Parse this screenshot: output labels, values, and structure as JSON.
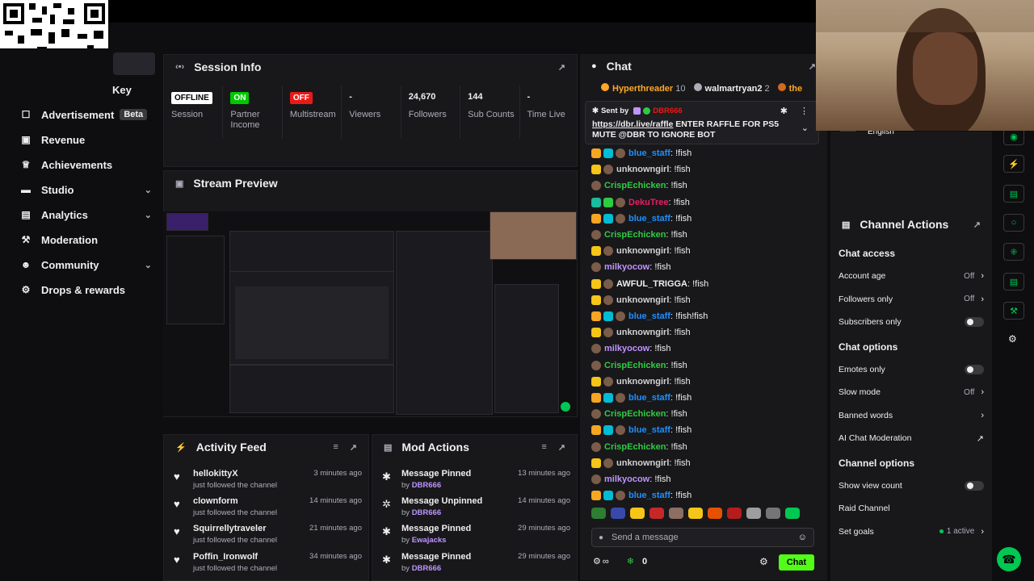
{
  "sidebar": {
    "key_label": "Key",
    "items": [
      {
        "label": "Advertisement",
        "badge": "Beta",
        "icon": "ad-icon"
      },
      {
        "label": "Revenue",
        "icon": "revenue-icon"
      },
      {
        "label": "Achievements",
        "icon": "trophy-icon"
      },
      {
        "label": "Studio",
        "icon": "studio-icon",
        "chevron": true
      },
      {
        "label": "Analytics",
        "icon": "analytics-icon",
        "chevron": true
      },
      {
        "label": "Moderation",
        "icon": "wrench-icon"
      },
      {
        "label": "Community",
        "icon": "community-icon",
        "chevron": true
      },
      {
        "label": "Drops & rewards",
        "icon": "drops-icon"
      }
    ]
  },
  "session": {
    "title": "Session Info",
    "stats": [
      {
        "value": "OFFLINE",
        "label": "Session",
        "kind": "tag",
        "color": "#ffffff",
        "text_color": "#000000"
      },
      {
        "value": "ON",
        "label": "Partner Income",
        "kind": "tag",
        "color": "#00c800",
        "text_color": "#ffffff"
      },
      {
        "value": "OFF",
        "label": "Multistream",
        "kind": "tag",
        "color": "#e91916",
        "text_color": "#ffffff"
      },
      {
        "value": "-",
        "label": "Viewers",
        "kind": "text"
      },
      {
        "value": "24,670",
        "label": "Followers",
        "kind": "text"
      },
      {
        "value": "144",
        "label": "Sub Counts",
        "kind": "text"
      },
      {
        "value": "-",
        "label": "Time Live",
        "kind": "text"
      }
    ]
  },
  "preview": {
    "title": "Stream Preview"
  },
  "activity": {
    "title": "Activity Feed",
    "items": [
      {
        "name": "hellokittyX",
        "sub": "just followed the channel",
        "time": "3 minutes ago"
      },
      {
        "name": "clownform",
        "sub": "just followed the channel",
        "time": "14 minutes ago"
      },
      {
        "name": "Squirrellytraveler",
        "sub": "just followed the channel",
        "time": "21 minutes ago"
      },
      {
        "name": "Poffin_Ironwolf",
        "sub": "just followed the channel",
        "time": "34 minutes ago"
      }
    ]
  },
  "mod": {
    "title": "Mod Actions",
    "items": [
      {
        "action": "Message Pinned",
        "by_label": "by",
        "by": "DBR666",
        "time": "13 minutes ago",
        "icon": "pin-icon"
      },
      {
        "action": "Message Unpinned",
        "by_label": "by",
        "by": "DBR666",
        "time": "14 minutes ago",
        "icon": "unpin-icon"
      },
      {
        "action": "Message Pinned",
        "by_label": "by",
        "by": "Ewajacks",
        "time": "29 minutes ago",
        "icon": "pin-icon"
      },
      {
        "action": "Message Pinned",
        "by_label": "by",
        "by": "DBR666",
        "time": "29 minutes ago",
        "icon": "pin-icon"
      }
    ]
  },
  "chat": {
    "title": "Chat",
    "leaderboard": [
      {
        "name": "Hyperthreader",
        "count": "10",
        "color": "#ffa726"
      },
      {
        "name": "walmartryan2",
        "count": "2",
        "color": "#efeff1"
      },
      {
        "name": "the",
        "count": "",
        "color": "#ffa726"
      }
    ],
    "pinned": {
      "sent_by": "Sent by",
      "author": "DBR666",
      "link": "https://dbr.live/raffle",
      "text": " ENTER RAFFLE FOR PS5 MUTE @DBR TO IGNORE BOT"
    },
    "messages": [
      {
        "user": "blue_staff",
        "text": ": !fish",
        "color": "#1e90ff",
        "badges": [
          "#f5a623",
          "#00bcd4"
        ]
      },
      {
        "user": "unknowngirl",
        "text": ": !fish",
        "color": "#d2d2d2",
        "badges": [
          "#f5c518"
        ]
      },
      {
        "user": "CrispEchicken",
        "text": ": !fish",
        "color": "#2ecc40",
        "badges": []
      },
      {
        "user": "DekuTree",
        "text": ": !fish",
        "color": "#e91e63",
        "badges": [
          "#1abc9c",
          "#2ecc40"
        ]
      },
      {
        "user": "blue_staff",
        "text": ": !fish",
        "color": "#1e90ff",
        "badges": [
          "#f5a623",
          "#00bcd4"
        ]
      },
      {
        "user": "CrispEchicken",
        "text": ": !fish",
        "color": "#2ecc40",
        "badges": []
      },
      {
        "user": "unknowngirl",
        "text": ": !fish",
        "color": "#d2d2d2",
        "badges": [
          "#f5c518"
        ]
      },
      {
        "user": "milkyocow",
        "text": ": !fish",
        "color": "#bf94ff",
        "badges": []
      },
      {
        "user": "AWFUL_TRIGGA",
        "text": ": !fish",
        "color": "#efeff1",
        "badges": [
          "#f5c518"
        ]
      },
      {
        "user": "unknowngirl",
        "text": ": !fish",
        "color": "#d2d2d2",
        "badges": [
          "#f5c518"
        ]
      },
      {
        "user": "blue_staff",
        "text": ": !fish!fish",
        "color": "#1e90ff",
        "badges": [
          "#f5a623",
          "#00bcd4"
        ]
      },
      {
        "user": "unknowngirl",
        "text": ": !fish",
        "color": "#d2d2d2",
        "badges": [
          "#f5c518"
        ]
      },
      {
        "user": "milkyocow",
        "text": ": !fish",
        "color": "#bf94ff",
        "badges": []
      },
      {
        "user": "CrispEchicken",
        "text": ": !fish",
        "color": "#2ecc40",
        "badges": []
      },
      {
        "user": "unknowngirl",
        "text": ": !fish",
        "color": "#d2d2d2",
        "badges": [
          "#f5c518"
        ]
      },
      {
        "user": "blue_staff",
        "text": ": !fish",
        "color": "#1e90ff",
        "badges": [
          "#f5a623",
          "#00bcd4"
        ]
      },
      {
        "user": "CrispEchicken",
        "text": ": !fish",
        "color": "#2ecc40",
        "badges": []
      },
      {
        "user": "blue_staff",
        "text": ": !fish",
        "color": "#1e90ff",
        "badges": [
          "#f5a623",
          "#00bcd4"
        ]
      },
      {
        "user": "CrispEchicken",
        "text": ": !fish",
        "color": "#2ecc40",
        "badges": []
      },
      {
        "user": "unknowngirl",
        "text": ": !fish",
        "color": "#d2d2d2",
        "badges": [
          "#f5c518"
        ]
      },
      {
        "user": "milkyocow",
        "text": ": !fish",
        "color": "#bf94ff",
        "badges": []
      },
      {
        "user": "blue_staff",
        "text": ": !fish",
        "color": "#1e90ff",
        "badges": [
          "#f5a623",
          "#00bcd4"
        ]
      }
    ],
    "input_placeholder": "Send a message",
    "points": "0",
    "chat_button": "Chat"
  },
  "language": "English",
  "actions": {
    "title": "Channel Actions",
    "sections": [
      {
        "title": "Chat access",
        "rows": [
          {
            "label": "Account age",
            "value": "Off",
            "control": "arrow"
          },
          {
            "label": "Followers only",
            "value": "Off",
            "control": "arrow"
          },
          {
            "label": "Subscribers only",
            "value": "",
            "control": "toggle"
          }
        ]
      },
      {
        "title": "Chat options",
        "rows": [
          {
            "label": "Emotes only",
            "value": "",
            "control": "toggle"
          },
          {
            "label": "Slow mode",
            "value": "Off",
            "control": "arrow"
          },
          {
            "label": "Banned words",
            "value": "",
            "control": "arrow"
          },
          {
            "label": "AI Chat Moderation",
            "value": "",
            "control": "external"
          }
        ]
      },
      {
        "title": "Channel options",
        "rows": [
          {
            "label": "Show view count",
            "value": "",
            "control": "toggle"
          },
          {
            "label": "Raid Channel",
            "value": "",
            "control": "none"
          },
          {
            "label": "Set goals",
            "value": "1 active",
            "control": "arrow"
          }
        ]
      }
    ]
  },
  "colors": {
    "accent": "#53fc18",
    "panel": "#18181b",
    "bg": "#0e0e10"
  }
}
